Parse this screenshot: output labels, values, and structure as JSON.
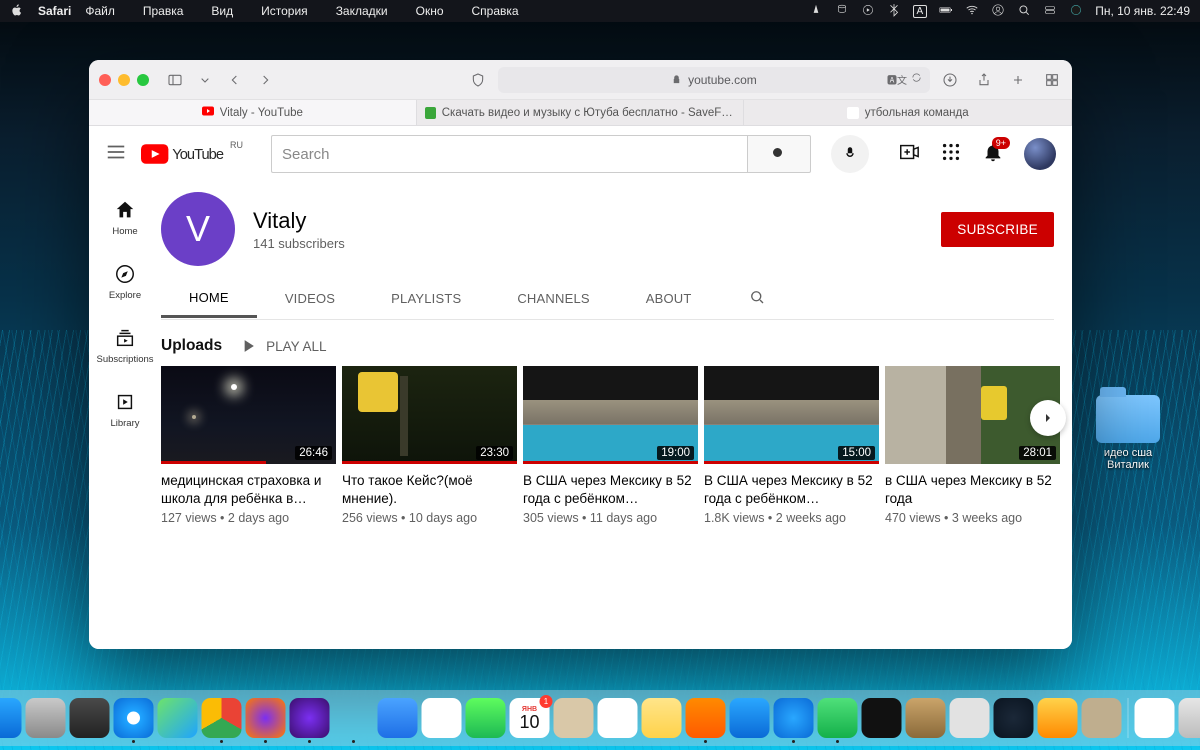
{
  "menubar": {
    "app": "Safari",
    "items": [
      "Файл",
      "Правка",
      "Вид",
      "История",
      "Закладки",
      "Окно",
      "Справка"
    ],
    "clock": "Пн, 10 янв. 22:49"
  },
  "desktop_icon": {
    "line1": "идео сша",
    "line2": "Виталик"
  },
  "safari": {
    "address": "youtube.com",
    "tabs": [
      {
        "label": "Vitaly - YouTube",
        "fav": "#ff0000",
        "active": true
      },
      {
        "label": "Скачать видео и музыку с Ютуба бесплатно - SaveFrom.net",
        "fav": "#3aa63a"
      },
      {
        "label": "утбольная команда",
        "fav": "#ffffff"
      }
    ]
  },
  "youtube": {
    "logo_region": "RU",
    "search_placeholder": "Search",
    "notif_badge": "9+",
    "rail": [
      {
        "key": "home",
        "label": "Home"
      },
      {
        "key": "explore",
        "label": "Explore"
      },
      {
        "key": "subs",
        "label": "Subscriptions"
      },
      {
        "key": "library",
        "label": "Library"
      }
    ],
    "channel": {
      "initial": "V",
      "name": "Vitaly",
      "subscribers": "141 subscribers",
      "subscribe_label": "SUBSCRIBE",
      "tabs": [
        "HOME",
        "VIDEOS",
        "PLAYLISTS",
        "CHANNELS",
        "ABOUT"
      ]
    },
    "uploads": {
      "title": "Uploads",
      "play_all": "PLAY ALL",
      "videos": [
        {
          "title": "медицинская страховка и школа для ребёнка в…",
          "meta": "127 views • 2 days ago",
          "duration": "26:46",
          "progress": 60,
          "thumb": "street"
        },
        {
          "title": "Что такое Кейс?(моё мнение).",
          "meta": "256 views • 10 days ago",
          "duration": "23:30",
          "progress": 100,
          "thumb": "sign"
        },
        {
          "title": "В США через Мексику в 52 года с ребёнком…",
          "meta": "305 views • 11 days ago",
          "duration": "19:00",
          "progress": 100,
          "thumb": "pool"
        },
        {
          "title": "В США через Мексику в 52 года с ребёнком…",
          "meta": "1.8K views • 2 weeks ago",
          "duration": "15:00",
          "progress": 100,
          "thumb": "pool"
        },
        {
          "title": "в США через Мексику в 52 года",
          "meta": "470 views • 3 weeks ago",
          "duration": "28:01",
          "progress": 0,
          "thumb": "yard"
        }
      ]
    }
  },
  "dock": {
    "date_badge": "1",
    "date_day": "10",
    "date_month": "ЯНВ",
    "apps": [
      {
        "name": "finder",
        "bg": "linear-gradient(#29a7ff,#0a6ad6)"
      },
      {
        "name": "launchpad",
        "bg": "linear-gradient(#c9c9c9,#8a8a8a)"
      },
      {
        "name": "settings",
        "bg": "linear-gradient(#4a4a4a,#222)"
      },
      {
        "name": "safari",
        "bg": "radial-gradient(circle,#fff 22%,#1fa4ff 24%,#0a6ad6 100%)",
        "dot": true
      },
      {
        "name": "maps",
        "bg": "linear-gradient(135deg,#6de36a,#1fa4ff)"
      },
      {
        "name": "chrome",
        "bg": "conic-gradient(#ea4335 0 120deg,#34a853 120deg 240deg,#fbbc05 240deg 360deg)",
        "dot": true
      },
      {
        "name": "firefox",
        "bg": "radial-gradient(circle,#7b2ff2,#ff7b00)",
        "dot": true
      },
      {
        "name": "tor",
        "bg": "radial-gradient(circle,#7b2ff2,#3a0e6a)",
        "dot": true
      },
      {
        "name": "messages",
        "bg": "linear-gradient(#5ef c5e,#1db954)",
        "dot": true
      },
      {
        "name": "mail",
        "bg": "linear-gradient(#4aa3ff,#1e6fe6)"
      },
      {
        "name": "photos",
        "bg": "#fff"
      },
      {
        "name": "facetime",
        "bg": "linear-gradient(#5efc5e,#1db954)"
      },
      {
        "name": "calendar",
        "bg": "#fff",
        "cal": true
      },
      {
        "name": "contacts",
        "bg": "#d9c8a8"
      },
      {
        "name": "reminders",
        "bg": "#fff"
      },
      {
        "name": "notes",
        "bg": "linear-gradient(#ffe58a,#ffd24a)"
      },
      {
        "name": "vlc",
        "bg": "linear-gradient(#ff8a00,#ff5a00)",
        "dot": true
      },
      {
        "name": "app1",
        "bg": "linear-gradient(#2aa7ff,#0a6ad6)"
      },
      {
        "name": "telegram",
        "bg": "radial-gradient(circle,#29a7ff,#0a6ad6)",
        "dot": true
      },
      {
        "name": "whatsapp",
        "bg": "linear-gradient(#4fe07a,#14b04a)",
        "dot": true
      },
      {
        "name": "app2",
        "bg": "#111"
      },
      {
        "name": "chess",
        "bg": "linear-gradient(#caa46a,#8a6a3a)"
      },
      {
        "name": "roblox",
        "bg": "#e2e2e2"
      },
      {
        "name": "steam",
        "bg": "radial-gradient(circle,#1b2838,#0a1420)"
      },
      {
        "name": "app3",
        "bg": "linear-gradient(#ffd24a,#ff8a00)"
      },
      {
        "name": "app4",
        "bg": "#bfae8e"
      }
    ],
    "tray": [
      {
        "name": "downloads",
        "bg": "#fff"
      },
      {
        "name": "trash",
        "bg": "linear-gradient(#e6e6e6,#bcbcbc)"
      }
    ]
  }
}
